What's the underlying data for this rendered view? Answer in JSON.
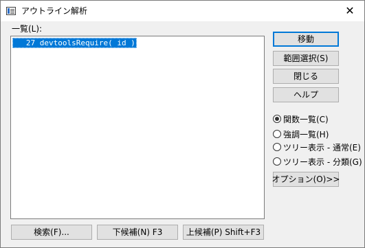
{
  "window": {
    "title": "アウトライン解析",
    "close_glyph": "✕"
  },
  "list": {
    "label": "一覧(L):",
    "items": [
      {
        "text": "   27 devtoolsRequire( id )"
      }
    ]
  },
  "buttons": {
    "move": "移動",
    "select_range": "範囲選択(S)",
    "close": "閉じる",
    "help": "ヘルプ",
    "options": "オプション(O)>>",
    "search": "検索(F)...",
    "next_candidate": "下候補(N) F3",
    "prev_candidate": "上候補(P) Shift+F3"
  },
  "radios": [
    {
      "label": "関数一覧(C)",
      "checked": true
    },
    {
      "label": "強調一覧(H)",
      "checked": false
    },
    {
      "label": "ツリー表示 - 通常(E)",
      "checked": false
    },
    {
      "label": "ツリー表示 - 分類(G)",
      "checked": false
    }
  ],
  "icons": {
    "app": "outline-app-icon",
    "close": "close-icon"
  },
  "colors": {
    "selection": "#0078d7",
    "default_button_border": "#0078d7"
  }
}
